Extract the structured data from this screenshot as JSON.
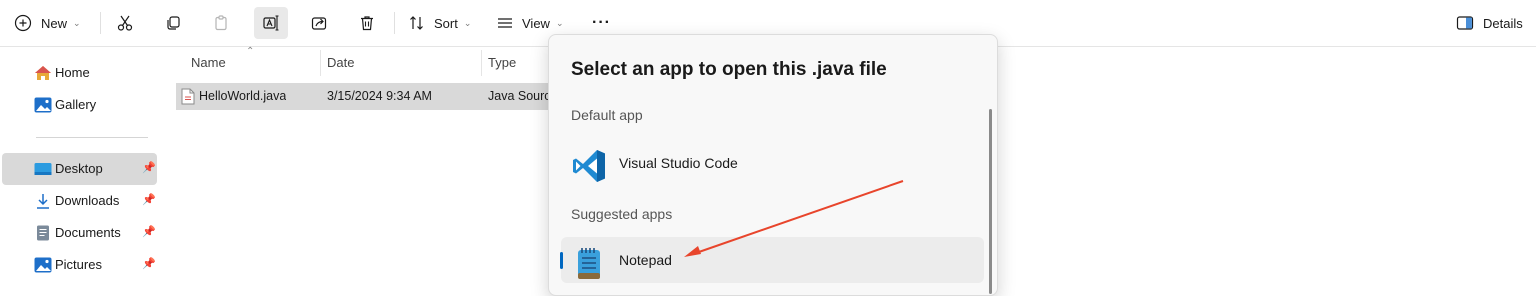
{
  "toolbar": {
    "new_label": "New",
    "sort_label": "Sort",
    "view_label": "View",
    "more_label": "···",
    "details_label": "Details"
  },
  "sidebar": {
    "items": [
      {
        "label": "Home",
        "icon": "home-icon"
      },
      {
        "label": "Gallery",
        "icon": "gallery-icon"
      },
      {
        "label": "Desktop",
        "icon": "desktop-icon",
        "pinned": true,
        "selected": true
      },
      {
        "label": "Downloads",
        "icon": "download-icon",
        "pinned": true
      },
      {
        "label": "Documents",
        "icon": "documents-icon",
        "pinned": true
      },
      {
        "label": "Pictures",
        "icon": "pictures-icon",
        "pinned": true
      }
    ]
  },
  "file_list": {
    "columns": [
      "Name",
      "Date",
      "Type"
    ],
    "rows": [
      {
        "name": "HelloWorld.java",
        "date": "3/15/2024 9:34 AM",
        "type": "Java Source"
      }
    ]
  },
  "open_with_dialog": {
    "title": "Select an app to open this .java file",
    "default_section": "Default app",
    "default_app": "Visual Studio Code",
    "suggested_section": "Suggested apps",
    "suggested_apps": [
      "Notepad"
    ]
  },
  "colors": {
    "accent": "#0067c0",
    "annotation_arrow": "#e8452c",
    "selection": "#d9d9d9"
  }
}
